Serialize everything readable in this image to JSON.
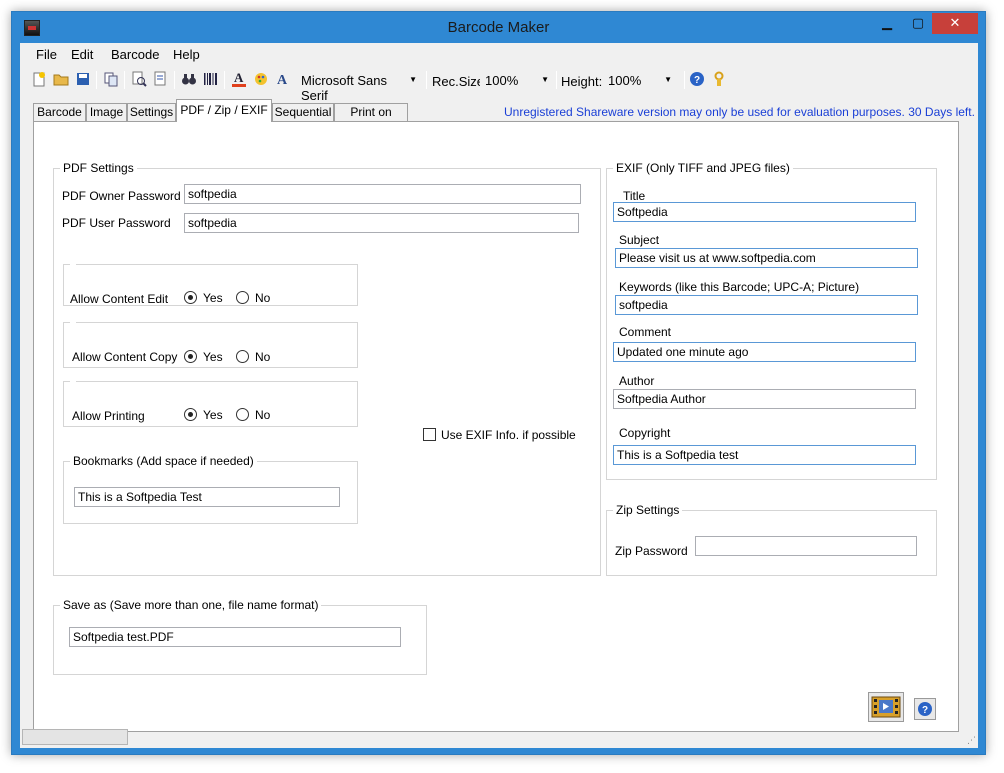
{
  "window": {
    "title": "Barcode Maker"
  },
  "menu": [
    "File",
    "Edit",
    "Barcode",
    "Help"
  ],
  "toolbar": {
    "font_name": "Microsoft Sans Serif",
    "rec_size_label": "Rec.Size",
    "rec_size_value": "100%",
    "height_label": "Height:",
    "height_value": "100%",
    "icons": [
      "new-document-icon",
      "open-folder-icon",
      "save-icon",
      "copy-icon",
      "print-preview-icon",
      "page-setup-icon",
      "binoculars-icon",
      "barcode-icon",
      "font-color-icon",
      "color-palette-icon",
      "font-icon",
      "help-icon",
      "key-icon"
    ]
  },
  "tabs": [
    "Barcode",
    "Image",
    "Settings",
    "PDF / Zip / EXIF",
    "Sequential",
    "Print on Label"
  ],
  "active_tab": "PDF / Zip / EXIF",
  "notice": "Unregistered Shareware version may only be used for evaluation purposes. 30 Days left.",
  "pdf": {
    "legend": "PDF Settings",
    "owner_password_label": "PDF Owner Password",
    "owner_password_value": "softpedia",
    "user_password_label": "PDF User Password",
    "user_password_value": "softpedia",
    "yes_label": "Yes",
    "no_label": "No",
    "allow_edit_label": "Allow Content Edit",
    "allow_edit": "Yes",
    "allow_copy_label": "Allow Content Copy",
    "allow_copy": "Yes",
    "allow_print_label": "Allow Printing",
    "allow_print": "Yes",
    "bookmarks_legend": "Bookmarks (Add space if needed)",
    "bookmarks_value": "This is a Softpedia Test",
    "use_exif_label": "Use EXIF Info. if possible",
    "use_exif_checked": false
  },
  "exif": {
    "legend": "EXIF (Only TIFF and JPEG files)",
    "title_label": "Title",
    "title_value": "Softpedia",
    "subject_label": "Subject",
    "subject_value": "Please visit us at www.softpedia.com",
    "keywords_label": "Keywords (like this Barcode; UPC-A; Picture)",
    "keywords_value": "softpedia",
    "comment_label": "Comment",
    "comment_value": "Updated one minute ago",
    "author_label": "Author",
    "author_value": "Softpedia Author",
    "copyright_label": "Copyright",
    "copyright_value": "This is a Softpedia test"
  },
  "zip": {
    "legend": "Zip Settings",
    "password_label": "Zip Password",
    "password_value": ""
  },
  "save": {
    "legend": "Save as (Save more than one, file name format)",
    "value": "Softpedia test.PDF"
  },
  "colors": {
    "titlebar": "#2f88d3",
    "close": "#c7403a",
    "notice": "#1a3fd6",
    "panel": "#f0f0f0"
  }
}
